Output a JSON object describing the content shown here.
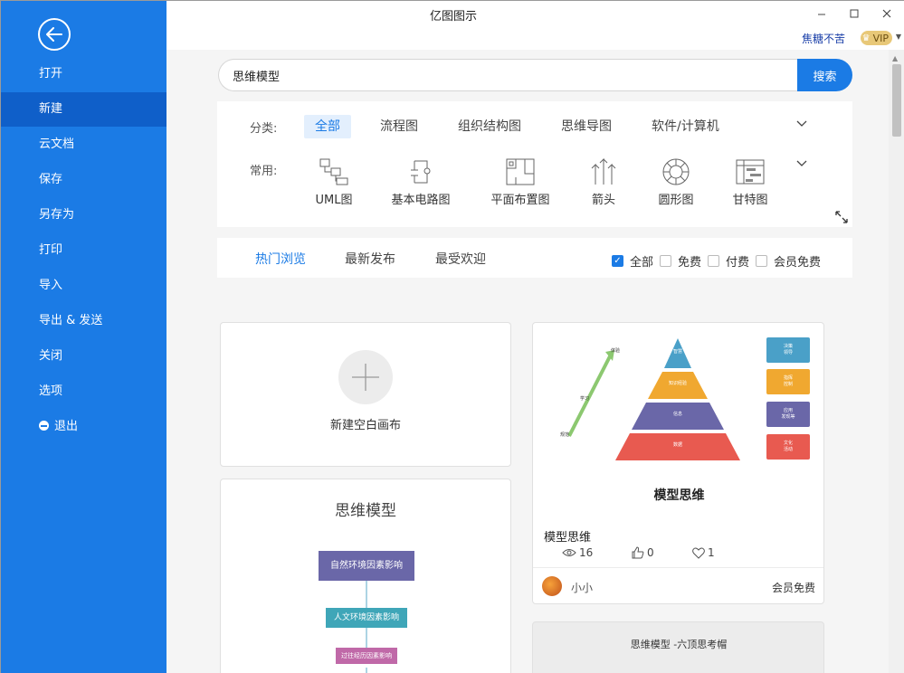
{
  "app": {
    "title": "亿图图示"
  },
  "user": {
    "name": "焦糖不苦",
    "vip_label": "VIP"
  },
  "sidebar": {
    "items": [
      {
        "label": "打开"
      },
      {
        "label": "新建"
      },
      {
        "label": "云文档"
      },
      {
        "label": "保存"
      },
      {
        "label": "另存为"
      },
      {
        "label": "打印"
      },
      {
        "label": "导入"
      },
      {
        "label": "导出 & 发送"
      },
      {
        "label": "关闭"
      },
      {
        "label": "选项"
      },
      {
        "label": "退出"
      }
    ],
    "active_index": 1
  },
  "search": {
    "value": "思维模型",
    "button_label": "搜索"
  },
  "categories": {
    "label": "分类:",
    "items": [
      "全部",
      "流程图",
      "组织结构图",
      "思维导图",
      "软件/计算机"
    ],
    "active_index": 0
  },
  "common": {
    "label": "常用:",
    "items": [
      {
        "label": "UML图",
        "icon": "uml-icon"
      },
      {
        "label": "基本电路图",
        "icon": "circuit-icon"
      },
      {
        "label": "平面布置图",
        "icon": "floorplan-icon"
      },
      {
        "label": "箭头",
        "icon": "arrow-icon"
      },
      {
        "label": "圆形图",
        "icon": "circle-chart-icon"
      },
      {
        "label": "甘特图",
        "icon": "gantt-icon"
      }
    ]
  },
  "tabs": {
    "items": [
      "热门浏览",
      "最新发布",
      "最受欢迎"
    ],
    "active_index": 0
  },
  "filters": [
    {
      "label": "全部",
      "checked": true
    },
    {
      "label": "免费",
      "checked": false
    },
    {
      "label": "付费",
      "checked": false
    },
    {
      "label": "会员免费",
      "checked": false
    }
  ],
  "new_blank": {
    "label": "新建空白画布"
  },
  "template_preview_mind": {
    "title": "思维模型",
    "boxes": [
      "自然环境因素影响",
      "人文环境因素影响",
      "过往经历因素影响"
    ]
  },
  "template_card": {
    "preview_title": "模型思维",
    "pyramid_levels": [
      "智慧",
      "知识经验",
      "信息",
      "数据"
    ],
    "side_labels": [
      "决策\n领导",
      "指挥\n控制",
      "应用\n发现等",
      "文化\n活动"
    ],
    "arrow_labels": [
      "体验",
      "学习",
      "规范"
    ],
    "title": "模型思维",
    "views": "16",
    "likes": "0",
    "favorites": "1",
    "author": "小小",
    "price": "会员免费"
  },
  "template_card_3": {
    "title": "思维模型 -六顶思考帽"
  },
  "colors": {
    "sidebar_bg": "#1b7be5",
    "sidebar_active": "#0f5fc9",
    "accent": "#1b7be5",
    "vip_gold": "#e8c878"
  }
}
